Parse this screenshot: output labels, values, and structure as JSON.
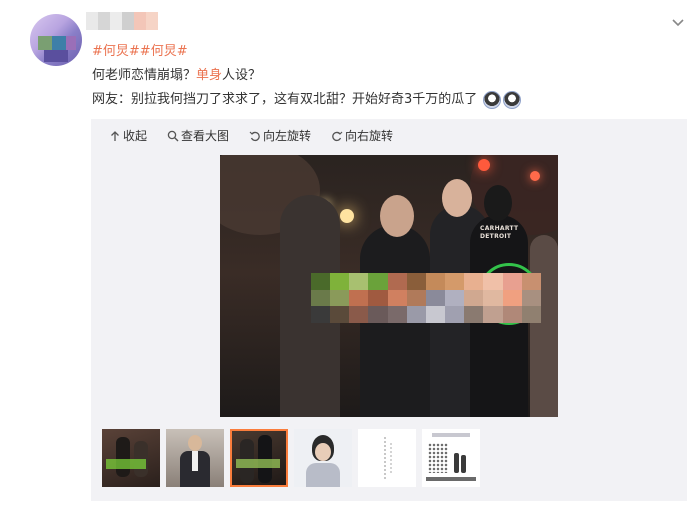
{
  "post": {
    "tags": [
      "#何炅#",
      "#何炅#"
    ],
    "line1_pre": "何老师恋情崩塌？",
    "line1_highlight": "单身",
    "line1_post": "人设？",
    "line2": "网友：别拉我何挡刀了求求了，这有双北甜？开始好奇3千万的瓜了"
  },
  "emojis": [
    "doge-emoji",
    "doge-emoji"
  ],
  "toolbar": {
    "collapse": "收起",
    "view_large": "查看大图",
    "rotate_left": "向左旋转",
    "rotate_right": "向右旋转"
  },
  "photo": {
    "jacket_text": "CARHARTT DETROIT"
  },
  "thumbnails": [
    {
      "name": "thumb-1",
      "active": false
    },
    {
      "name": "thumb-2",
      "active": false
    },
    {
      "name": "thumb-3",
      "active": true
    },
    {
      "name": "thumb-4",
      "active": false
    },
    {
      "name": "thumb-5",
      "active": false
    },
    {
      "name": "thumb-6",
      "active": false
    }
  ],
  "colors": {
    "accent": "#eb7350",
    "thumb_active_border": "#fa7d3c",
    "media_bg": "#f2f2f5"
  }
}
